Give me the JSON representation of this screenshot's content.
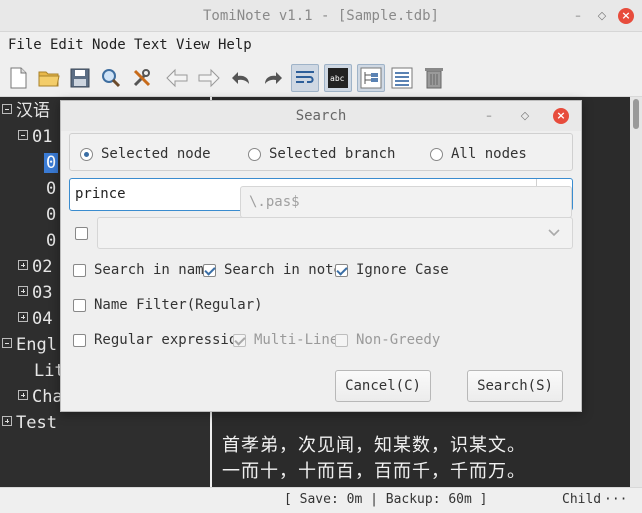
{
  "window": {
    "title": "TomiNote v1.1 - [Sample.tdb]",
    "controls": [
      "minimize-icon",
      "restore-icon",
      "close-icon"
    ],
    "close_glyph": "×",
    "min_glyph": "–",
    "restore_glyph": "◇"
  },
  "menu": [
    "File",
    "Edit",
    "Node",
    "Text",
    "View",
    "Help"
  ],
  "toolbar": {
    "icons": [
      "new-file-icon",
      "open-folder-icon",
      "save-icon",
      "search-icon",
      "tools-icon",
      "back-arrow-icon",
      "forward-arrow-icon",
      "undo-icon",
      "redo-icon",
      "word-wrap-icon",
      "text-preview-icon",
      "tree-view-icon",
      "list-view-icon",
      "recycle-bin-icon"
    ],
    "active": [
      "word-wrap-icon",
      "text-preview-icon",
      "tree-view-icon"
    ],
    "accent": "#3a6ea5"
  },
  "tree": {
    "background": "#2e2e2e",
    "items": [
      {
        "label": "汉语",
        "expander": "minus"
      },
      {
        "label": "01",
        "expander": "minus"
      },
      {
        "label": "0",
        "expander": "none",
        "selected": true
      },
      {
        "label": "0",
        "expander": "none"
      },
      {
        "label": "0",
        "expander": "none"
      },
      {
        "label": "0",
        "expander": "none"
      },
      {
        "label": "02",
        "expander": "plus"
      },
      {
        "label": "03",
        "expander": "plus"
      },
      {
        "label": "04",
        "expander": "plus"
      },
      {
        "label": "Engl",
        "expander": "minus"
      },
      {
        "label": "Lit",
        "expander": "none"
      },
      {
        "label": "Cha",
        "expander": "plus"
      },
      {
        "label": "Test",
        "expander": "plus"
      }
    ]
  },
  "editor": {
    "lines": [
      "首孝弟，次见闻，知某数，识某文。",
      "一而十，十而百，百而千，千而万。"
    ]
  },
  "status": {
    "save_info": "[ Save: 0m | Backup: 60m ]",
    "node_info": "Child",
    "more": "···"
  },
  "dialog": {
    "title": "Search",
    "scope": {
      "options": [
        "Selected node",
        "Selected branch",
        "All nodes"
      ],
      "selected": "Selected node"
    },
    "search_text": "prince",
    "replace_enabled": false,
    "replace_text": "",
    "options": {
      "search_in_name": {
        "label": "Search in name",
        "checked": false
      },
      "search_in_note": {
        "label": "Search in note",
        "checked": true
      },
      "ignore_case": {
        "label": "Ignore Case",
        "checked": true
      }
    },
    "name_filter": {
      "label": "Name Filter(Regular)",
      "checked": false,
      "placeholder": "\\.pas$"
    },
    "regex": {
      "label": "Regular expression",
      "checked": false,
      "multi_line": {
        "label": "Multi-Line",
        "checked": true,
        "enabled": false
      },
      "non_greedy": {
        "label": "Non-Greedy",
        "checked": false,
        "enabled": false
      }
    },
    "buttons": {
      "cancel": "Cancel(C)",
      "search": "Search(S)"
    }
  }
}
